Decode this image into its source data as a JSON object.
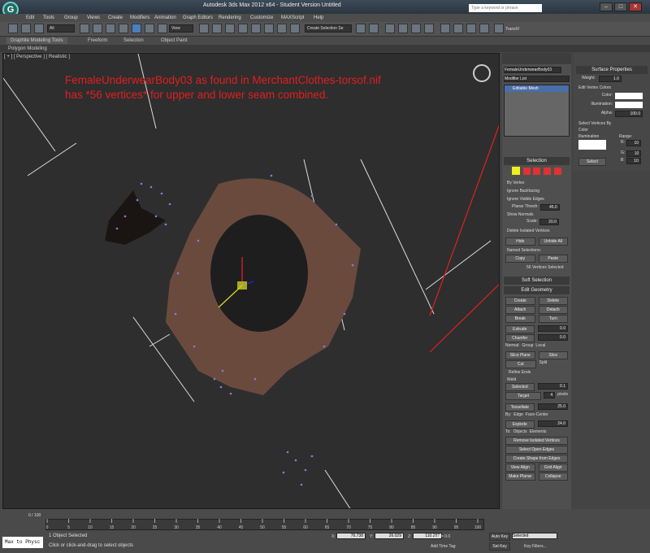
{
  "app": {
    "title": "Autodesk 3ds Max  2012 x64   - Student Version     Untitled",
    "search_placeholder": "Type a keyword or phrase"
  },
  "menu": [
    "Edit",
    "Tools",
    "Group",
    "Views",
    "Create",
    "Modifiers",
    "Animation",
    "Graph Editors",
    "Rendering",
    "Customize",
    "MAXScript",
    "Help"
  ],
  "toolbar": {
    "filter": "All",
    "view": "View",
    "selection_set": "Create Selection Se",
    "app_label": "TransIV"
  },
  "ribbon": {
    "tabs": [
      "Graphite Modeling Tools",
      "Freeform",
      "Selection",
      "Object Paint"
    ],
    "sub": "Polygon Modeling"
  },
  "viewport": {
    "label": "[ + ] [ Perspective ] [ Realistic ]",
    "annotation_line1": "FemaleUnderwearBody03 as found in MerchantClothes-torsof.nif",
    "annotation_line2": "has *56 vertices* for upper and lower seam combined."
  },
  "modify": {
    "object_name": "FemaleUnderwearBody03",
    "modifier_list": "Modifier List",
    "stack_item": "Editable Mesh"
  },
  "selection": {
    "title": "Selection",
    "by_vertex": "By Vertex",
    "ignore_backfacing": "Ignore Backfacing",
    "ignore_visible_edges": "Ignore Visible Edges",
    "planar_thresh": "Planar Thresh:",
    "planar_val": "45.0",
    "show_normals": "Show Normals",
    "scale_label": "Scale:",
    "scale_val": "20.0",
    "delete_isolated": "Delete Isolated Vertices",
    "hide": "Hide",
    "unhide_all": "Unhide All",
    "named_selections": "Named Selections:",
    "copy": "Copy",
    "paste": "Paste",
    "count": "56 Vertices Selected"
  },
  "soft_selection": "Soft Selection",
  "edit_geometry": {
    "title": "Edit Geometry",
    "create": "Create",
    "delete": "Delete",
    "attach": "Attach",
    "detach": "Detach",
    "break": "Break",
    "turn": "Turn",
    "extrude": "Extrude",
    "extrude_val": "0.0",
    "chamfer": "Chamfer",
    "chamfer_val": "0.0",
    "normal": "Normal:",
    "group": "Group",
    "local": "Local",
    "slice_plane": "Slice Plane",
    "slice": "Slice",
    "cut": "Cut",
    "split": "Split",
    "refine_ends": "Refine Ends",
    "weld": "Weld",
    "selected": "Selected",
    "selected_val": "0.1",
    "target": "Target",
    "target_val": "4",
    "pixels": "pixels",
    "tessellate": "Tessellate",
    "tess_val": "25.0",
    "by": "By:",
    "edge": "Edge",
    "face_center": "Face-Center",
    "explode": "Explode",
    "explode_val": "24.0",
    "to": "To:",
    "objects": "Objects",
    "elements": "Elements",
    "remove_isolated": "Remove Isolated Vertices",
    "select_open_edges": "Select Open Edges",
    "create_shape": "Create Shape from Edges",
    "view_align": "View Align",
    "grid_align": "Grid Align",
    "make_planar": "Make Planar",
    "collapse": "Collapse"
  },
  "surface": {
    "title": "Surface Properties",
    "weight": "Weight:",
    "weight_val": "1.0",
    "edit_vertex_colors": "Edit Vertex Colors",
    "color": "Color:",
    "illumination": "Illumination:",
    "alpha": "Alpha:",
    "alpha_val": "100.0",
    "select_by": "Select Vertices By",
    "opt_color": "Color",
    "opt_illum": "Illumination",
    "range": "Range:",
    "r": "R:",
    "g": "G:",
    "b": "B:",
    "rv": "10",
    "gv": "10",
    "bv": "10",
    "select": "Select"
  },
  "timeline": {
    "frame": "0 / 100",
    "ticks": [
      "0",
      "5",
      "10",
      "15",
      "20",
      "25",
      "30",
      "35",
      "40",
      "45",
      "50",
      "55",
      "60",
      "65",
      "70",
      "75",
      "80",
      "85",
      "90",
      "95",
      "100"
    ]
  },
  "status": {
    "script": "Max to Physc",
    "selected": "1 Object Selected",
    "hint": "Click or click-and-drag to select objects",
    "x": "76.738",
    "y": "26.029",
    "z": "110.287",
    "grid": "Grid = 0.0",
    "add_time_tag": "Add Time Tag",
    "auto_key": "Auto Key",
    "set_key": "Set Key",
    "key_mode": "Selected",
    "key_filters": "Key Filters...",
    "x_label": "X:",
    "y_label": "Y:",
    "z_label": "Z:"
  },
  "colors": {
    "annotation": "#e31e1e",
    "accent": "#1d6a63"
  }
}
